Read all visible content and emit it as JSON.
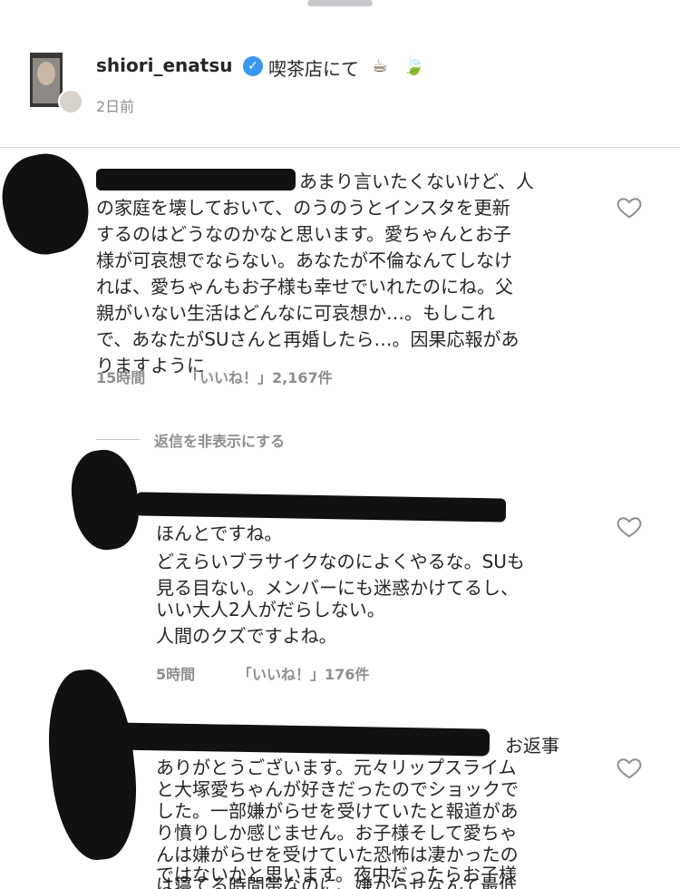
{
  "post": {
    "username": "shiori_enatsu",
    "caption": "喫茶店にて",
    "emoji_cup": "☕",
    "emoji_leaf": "🍃",
    "time": "2日前"
  },
  "comments": [
    {
      "lines": [
        "あまり言いたくないけど、人",
        "の家庭を壊しておいて、のうのうとインスタを更新",
        "するのはどうなのかなと思います。愛ちゃんとお子",
        "様が可哀想でならない。あなたが不倫なんてしなけ",
        "れば、愛ちゃんもお子様も幸せでいれたのにね。父",
        "親がいない生活はどんなに可哀想か…。もしこれ",
        "で、あなたがSUさんと再婚したら…。因果応報があ",
        "りますように"
      ],
      "time": "15時間",
      "likes": "「いいね！」2,167件"
    },
    {
      "lines": [
        "ほんとですね。",
        "どえらいブラサイクなのによくやるな。SUも",
        "見る目ない。メンバーにも迷惑かけてるし、",
        "いい大人2人がだらしない。",
        "人間のクズですよね。"
      ],
      "time": "5時間",
      "likes": "「いいね！」176件"
    },
    {
      "lines": [
        "お返事",
        "ありがとうございます。元々リップスライム",
        "と大塚愛ちゃんが好きだったのでショックで",
        "した。一部嫌がらせを受けていたと報道があ",
        "り憤りしか感じません。お子様そして愛ちゃ",
        "んは嫌がらせを受けていた恐怖は凄かったの",
        "ではないかと思います。夜中だったらお子様",
        "は寝てる時間帯なのに、嫌がらせなんて最低"
      ]
    }
  ],
  "hide_replies": "返信を非表示にする",
  "icons": {
    "heart": "heart-outline-icon",
    "verified": "verified-badge-icon"
  },
  "colors": {
    "secondary_text": "#8e8e8e",
    "verified_blue": "#3897f0"
  }
}
